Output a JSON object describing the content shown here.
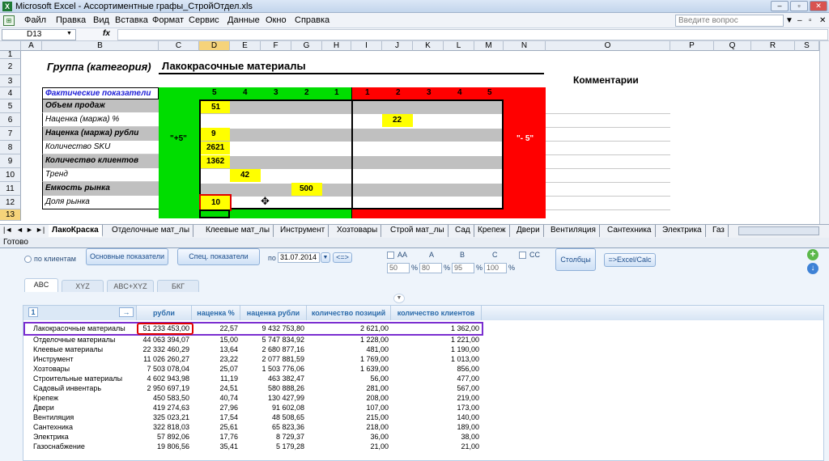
{
  "window": {
    "title": "Microsoft Excel - Ассортиментные графы_СтройОтдел.xls"
  },
  "menu": {
    "items": [
      "Файл",
      "Правка",
      "Вид",
      "Вставка",
      "Формат",
      "Сервис",
      "Данные",
      "Окно",
      "Справка"
    ],
    "help_placeholder": "Введите вопрос"
  },
  "formula_bar": {
    "cell_ref": "D13",
    "fx": "fx"
  },
  "columns": [
    "A",
    "B",
    "C",
    "D",
    "E",
    "F",
    "G",
    "H",
    "I",
    "J",
    "K",
    "L",
    "M",
    "N",
    "O",
    "P",
    "Q",
    "R",
    "S"
  ],
  "rows": [
    "1",
    "2",
    "3",
    "4",
    "5",
    "6",
    "7",
    "8",
    "9",
    "10",
    "11",
    "12",
    "13"
  ],
  "sheet": {
    "group_label": "Группа (категория)",
    "group_value": "Лакокрасочные материалы",
    "comments_label": "Комментарии",
    "header_label": "Фактические показатели",
    "green_scale": [
      "5",
      "4",
      "3",
      "2",
      "1"
    ],
    "red_scale": [
      "1",
      "2",
      "3",
      "4",
      "5"
    ],
    "plus_label": "\"+5\"",
    "minus_label": "\"- 5\"",
    "metrics": [
      "Объем продаж",
      "Наценка (маржа) %",
      "Наценка (маржа) рубли",
      "Количество SKU",
      "Количество клиентов",
      "Тренд",
      "Емкость рынка",
      "Доля рынка"
    ],
    "values": {
      "sales": "51",
      "markup_pct": "22",
      "markup_rub": "9",
      "sku": "2621",
      "clients": "1362",
      "trend": "42",
      "capacity": "500",
      "share": "10"
    }
  },
  "sheet_tabs": [
    "ЛакоКраска",
    "Отделочные мат_лы",
    "Клеевые мат_лы",
    "Инструмент",
    "Хозтовары",
    "Строй мат_лы",
    "Сад",
    "Крепеж",
    "Двери",
    "Вентиляция",
    "Сантехника",
    "Электрика",
    "Газ"
  ],
  "status": "Готово",
  "panel": {
    "by_clients": "по клиентам",
    "btn_main": "Основные показатели",
    "btn_special": "Спец. показатели",
    "date_label": "по",
    "date_value": "31.07.2014",
    "nav_btn": "<=>",
    "aa": "AA",
    "a": "A",
    "b": "B",
    "c": "C",
    "cc": "CC",
    "pct_values": [
      "50",
      "80",
      "95",
      "100"
    ],
    "pct_sign": "%",
    "btn_columns": "Столбцы",
    "btn_export": "=>Excel/Calc",
    "tabs": [
      "ABC",
      "XYZ",
      "ABC+XYZ",
      "БКГ"
    ],
    "grid_index": "1",
    "grid_headers": [
      "рубли",
      "наценка %",
      "наценка рубли",
      "количество позиций",
      "количество клиентов"
    ],
    "grid_rows": [
      [
        "Лакокрасочные материалы",
        "51 233 453,00",
        "22,57",
        "9 432 753,80",
        "2 621,00",
        "1 362,00"
      ],
      [
        "Отделочные материалы",
        "44 063 394,07",
        "15,00",
        "5 747 834,92",
        "1 228,00",
        "1 221,00"
      ],
      [
        "Клеевые материалы",
        "22 332 460,29",
        "13,64",
        "2 680 877,16",
        "481,00",
        "1 190,00"
      ],
      [
        "Инструмент",
        "11 026 260,27",
        "23,22",
        "2 077 881,59",
        "1 769,00",
        "1 013,00"
      ],
      [
        "Хозтовары",
        "7 503 078,04",
        "25,07",
        "1 503 776,06",
        "1 639,00",
        "856,00"
      ],
      [
        "Строительные материалы",
        "4 602 943,98",
        "11,19",
        "463 382,47",
        "56,00",
        "477,00"
      ],
      [
        "Садовый инвентарь",
        "2 950 697,19",
        "24,51",
        "580 888,26",
        "281,00",
        "567,00"
      ],
      [
        "Крепеж",
        "450 583,50",
        "40,74",
        "130 427,99",
        "208,00",
        "219,00"
      ],
      [
        "Двери",
        "419 274,63",
        "27,96",
        "91 602,08",
        "107,00",
        "173,00"
      ],
      [
        "Вентиляция",
        "325 023,21",
        "17,54",
        "48 508,65",
        "215,00",
        "140,00"
      ],
      [
        "Сантехника",
        "322 818,03",
        "25,61",
        "65 823,36",
        "218,00",
        "189,00"
      ],
      [
        "Электрика",
        "57 892,06",
        "17,76",
        "8 729,37",
        "36,00",
        "38,00"
      ],
      [
        "Газоснабжение",
        "19 806,56",
        "35,41",
        "5 179,28",
        "21,00",
        "21,00"
      ]
    ]
  }
}
